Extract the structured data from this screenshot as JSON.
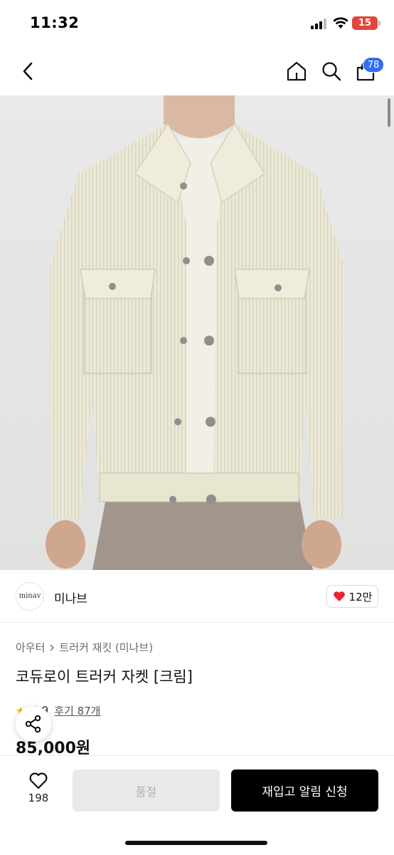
{
  "status_bar": {
    "time": "11:32",
    "battery_level": "15",
    "battery_color": "#e4453a"
  },
  "nav": {
    "back_icon": "chevron-left-icon",
    "home_icon": "home-icon",
    "search_icon": "search-icon",
    "cart_icon": "shopping-bag-icon",
    "cart_count": "78",
    "cart_badge_color": "#2e6df6"
  },
  "product_image": {
    "subject": "cream corduroy trucker jacket"
  },
  "brand": {
    "logo_text": "minav",
    "name": "미나브",
    "likes": "12만",
    "like_icon_color": "#e8232f"
  },
  "product": {
    "breadcrumb": [
      "아우터",
      "트러커 재킷 (미나브)"
    ],
    "title": "코듀로이 트러커 자켓 [크림]",
    "rating_score": "4.9",
    "review_label": "후기 87개",
    "price": "85,000원"
  },
  "bottom_bar": {
    "wish_count": "198",
    "option_label": "품절",
    "restock_label": "재입고 알림 신청"
  }
}
